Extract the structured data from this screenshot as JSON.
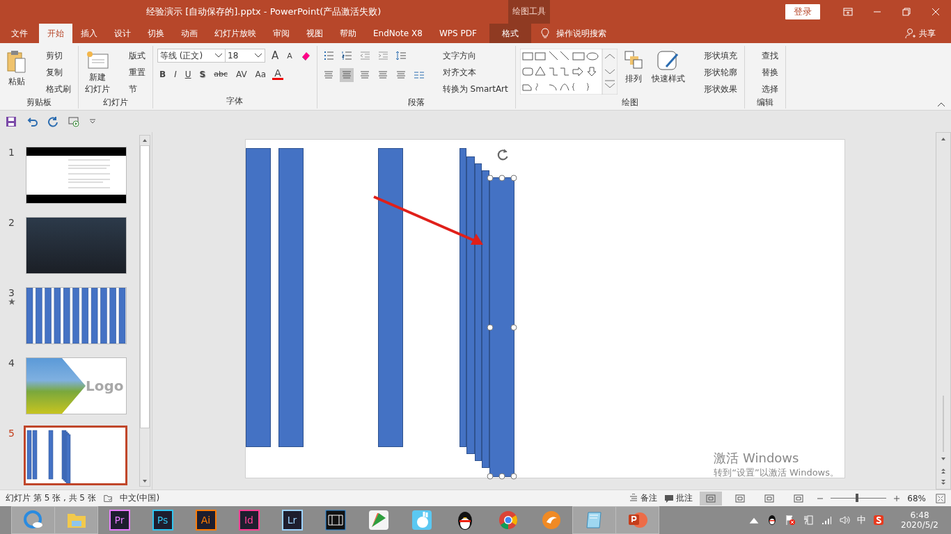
{
  "window": {
    "title": "经验演示 [自动保存的].pptx  -  PowerPoint(产品激活失败)",
    "context_group": "绘图工具",
    "login": "登录"
  },
  "tabs": [
    {
      "label": "文件",
      "selected": false,
      "kind": "normal"
    },
    {
      "label": "开始",
      "selected": true,
      "kind": "normal"
    },
    {
      "label": "插入",
      "selected": false,
      "kind": "normal"
    },
    {
      "label": "设计",
      "selected": false,
      "kind": "normal"
    },
    {
      "label": "切换",
      "selected": false,
      "kind": "normal"
    },
    {
      "label": "动画",
      "selected": false,
      "kind": "normal"
    },
    {
      "label": "幻灯片放映",
      "selected": false,
      "kind": "normal"
    },
    {
      "label": "审阅",
      "selected": false,
      "kind": "normal"
    },
    {
      "label": "视图",
      "selected": false,
      "kind": "normal"
    },
    {
      "label": "帮助",
      "selected": false,
      "kind": "normal"
    },
    {
      "label": "EndNote X8",
      "selected": false,
      "kind": "normal"
    },
    {
      "label": "WPS PDF",
      "selected": false,
      "kind": "normal"
    },
    {
      "label": "格式",
      "selected": false,
      "kind": "contextual"
    }
  ],
  "tell_me": "操作说明搜索",
  "share": "共享",
  "clipboard": {
    "label": "剪贴板",
    "paste": "粘贴",
    "items": [
      "剪切",
      "复制",
      "格式刷"
    ]
  },
  "slides_group": {
    "label": "幻灯片",
    "new_slide": [
      "新建",
      "幻灯片"
    ],
    "items": [
      "版式",
      "重置",
      "节"
    ]
  },
  "font": {
    "label": "字体",
    "family": "等线 (正文)",
    "size": "18",
    "grow": "A",
    "shrink": "A",
    "buttons": [
      "B",
      "I",
      "U",
      "S",
      "abc",
      "AV",
      "Aa"
    ],
    "color_button": "A"
  },
  "paragraph": {
    "label": "段落",
    "align": [
      {
        "selected": false
      },
      {
        "selected": true
      },
      {
        "selected": false
      },
      {
        "selected": false
      },
      {
        "selected": false
      }
    ],
    "items": [
      "文字方向",
      "对齐文本",
      "转换为 SmartArt"
    ]
  },
  "drawing": {
    "label": "绘图",
    "arrange": "排列",
    "quick_styles": "快速样式",
    "items": [
      "形状填充",
      "形状轮廓",
      "形状效果"
    ]
  },
  "editing": {
    "label": "编辑",
    "items": [
      "查找",
      "替换",
      "选择"
    ]
  },
  "thumbnails": [
    {
      "number": "1",
      "kind": "text",
      "selected": false,
      "animated": false
    },
    {
      "number": "2",
      "kind": "photo",
      "selected": false,
      "animated": false
    },
    {
      "number": "3",
      "kind": "bars",
      "selected": false,
      "animated": true
    },
    {
      "number": "4",
      "kind": "logo",
      "selected": false,
      "animated": false,
      "logo": "Logo"
    },
    {
      "number": "5",
      "kind": "shapes",
      "selected": true,
      "animated": false
    }
  ],
  "shapes": [
    {
      "selected": false
    },
    {
      "selected": false
    },
    {
      "selected": false
    },
    {
      "selected": false
    },
    {
      "selected": false
    },
    {
      "selected": false
    },
    {
      "selected": false
    },
    {
      "selected": true
    }
  ],
  "activation": {
    "title": "激活 Windows",
    "hint": "转到“设置”以激活 Windows。"
  },
  "status": {
    "slide_info": "幻灯片 第 5 张 , 共 5 张",
    "language": "中文(中国)",
    "notes": "备注",
    "comments": "批注",
    "views": [
      {
        "selected": true
      },
      {
        "selected": false
      },
      {
        "selected": false
      },
      {
        "selected": false
      }
    ],
    "zoom": {
      "level": 0.45,
      "value": "68%"
    }
  },
  "taskbar": {
    "apps": [
      {
        "kind": "browser",
        "active": true
      },
      {
        "kind": "folder",
        "active": true
      },
      {
        "kind": "adobe",
        "label": "Pr",
        "color": "#e77cff",
        "active": false
      },
      {
        "kind": "adobe",
        "label": "Ps",
        "color": "#31c5f0",
        "active": false
      },
      {
        "kind": "adobe",
        "label": "Ai",
        "color": "#ff7c00",
        "active": false
      },
      {
        "kind": "adobe",
        "label": "Id",
        "color": "#ff3f94",
        "active": false
      },
      {
        "kind": "adobe",
        "label": "Lr",
        "color": "#9dd4ff",
        "active": false
      },
      {
        "kind": "film",
        "active": false
      },
      {
        "kind": "chart",
        "active": false
      },
      {
        "kind": "rabbit",
        "active": false
      },
      {
        "kind": "penguin",
        "active": false
      },
      {
        "kind": "chrome",
        "active": false
      },
      {
        "kind": "cat",
        "active": false
      },
      {
        "kind": "notepad",
        "active": true
      },
      {
        "kind": "powerpoint",
        "active": true
      }
    ],
    "ime": "中",
    "time": "6:48",
    "date": "2020/5/2"
  }
}
